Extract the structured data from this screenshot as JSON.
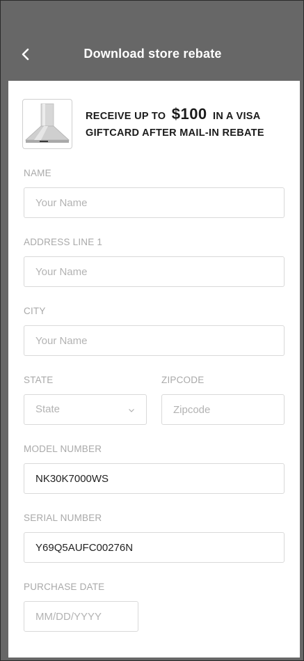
{
  "header": {
    "title": "Download store rebate",
    "back_icon": "chevron-left-icon"
  },
  "promo": {
    "image_icon": "range-hood-icon",
    "prefix": "RECEIVE UP TO",
    "amount": "$100",
    "suffix": "IN A VISA",
    "line2": "GIFTCARD AFTER MAIL-IN REBATE"
  },
  "form": {
    "name": {
      "label": "NAME",
      "placeholder": "Your Name"
    },
    "address": {
      "label": "ADDRESS LINE 1",
      "placeholder": "Your Name"
    },
    "city": {
      "label": "CITY",
      "placeholder": "Your Name"
    },
    "state": {
      "label": "STATE",
      "value": "State",
      "icon": "chevron-down-icon"
    },
    "zipcode": {
      "label": "ZIPCODE",
      "placeholder": "Zipcode"
    },
    "model_number": {
      "label": "MODEL NUMBER",
      "value": "NK30K7000WS"
    },
    "serial_number": {
      "label": "SERIAL NUMBER",
      "value": "Y69Q5AUFC00276N"
    },
    "purchase_date": {
      "label": "PURCHASE DATE",
      "placeholder": "MM/DD/YYYY"
    }
  },
  "colors": {
    "header_bg": "#676767",
    "card_bg": "#ffffff",
    "label": "#a9a9a9",
    "border": "#d9d9d9"
  }
}
